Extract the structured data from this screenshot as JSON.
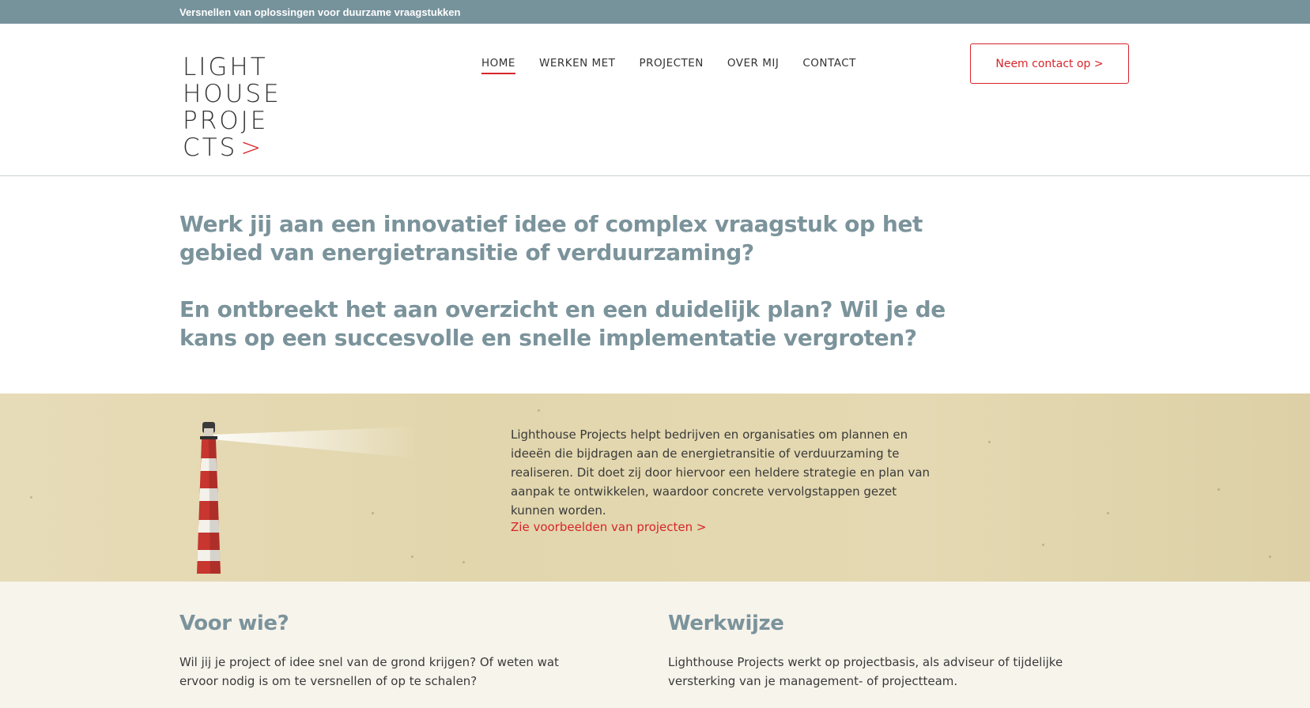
{
  "topbar": {
    "tagline": "Versnellen van oplossingen voor duurzame vraagstukken"
  },
  "logo": {
    "lines": [
      "LIGHT",
      "HOUSE",
      "PROJE",
      "CTS"
    ],
    "arrow": ">"
  },
  "nav": {
    "items": [
      "HOME",
      "WERKEN MET",
      "PROJECTEN",
      "OVER MIJ",
      "CONTACT"
    ],
    "active": "HOME"
  },
  "header": {
    "cta_label": "Neem contact op >"
  },
  "intro": {
    "heading_1": "Werk jij aan een innovatief idee of complex vraagstuk op het gebied van energietransitie of verduurzaming?",
    "heading_2": "En ontbreekt het aan overzicht en een duidelijk plan? Wil je de kans op een succesvolle en snelle implementatie vergroten?"
  },
  "banner": {
    "text": "Lighthouse Projects helpt bedrijven en organisaties om plannen en ideeën die bijdragen aan de energietransitie of verduurzaming te realiseren. Dit doet zij door hiervoor een heldere strategie en plan van aanpak te ontwikkelen, waardoor concrete vervolgstappen gezet kunnen worden.",
    "link": "Zie voorbeelden van projecten >"
  },
  "sections": {
    "left": {
      "title": "Voor wie?",
      "text": "Wil jij je project of idee snel van de grond krijgen? Of weten wat ervoor nodig is om te versnellen of op te schalen?"
    },
    "right": {
      "title": "Werkwijze",
      "text": "Lighthouse Projects werkt op projectbasis, als adviseur of tijdelijke versterking van je management- of projectteam."
    }
  },
  "colors": {
    "accent": "#d8242a",
    "slate": "#76929b",
    "heading": "#7b939b",
    "sand": "#e2d6ad",
    "cream": "#f7f4ec"
  },
  "icons": {
    "banner_image": "lighthouse-icon"
  }
}
